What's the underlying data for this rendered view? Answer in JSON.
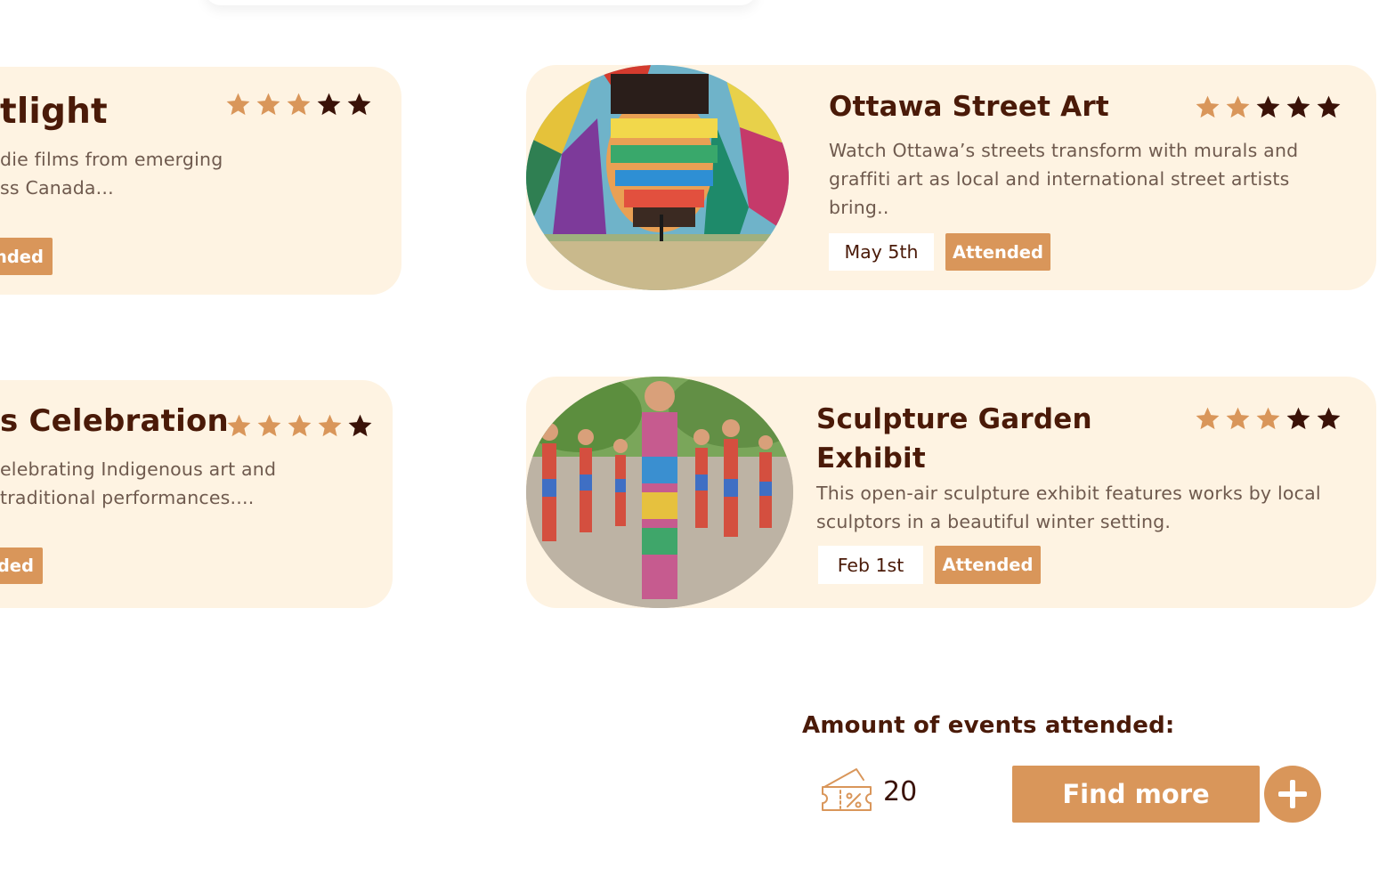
{
  "events": [
    {
      "title": "tlight",
      "desc_lines": [
        "die films from emerging",
        "ss Canada..."
      ],
      "rating": 3,
      "attended_label": "nded"
    },
    {
      "title": "Ottawa Street Art",
      "desc": "Watch Ottawa’s streets transform with murals and graffiti art as local and international street artists bring..",
      "rating": 2,
      "date": "May 5th",
      "attended_label": "Attended"
    },
    {
      "title": "s Celebration",
      "desc_lines": [
        "elebrating Indigenous art and",
        "traditional performances...."
      ],
      "rating": 4,
      "attended_label": "ded"
    },
    {
      "title_lines": [
        "Sculpture Garden",
        "Exhibit"
      ],
      "desc": "This open-air sculpture exhibit features works by local sculptors in a beautiful winter setting.",
      "rating": 3,
      "date": "Feb 1st",
      "attended_label": "Attended"
    }
  ],
  "stats": {
    "label": "Amount of events attended:",
    "count": "20",
    "find_more_label": "Find more"
  },
  "colors": {
    "card_bg": "#fef3e2",
    "accent": "#d9965a",
    "title": "#4a1a08",
    "star_filled": "#d9965a",
    "star_empty": "#3a1208"
  },
  "icons": {
    "ticket": "ticket-discount-icon",
    "plus": "plus-circle-icon",
    "star": "star-icon"
  }
}
